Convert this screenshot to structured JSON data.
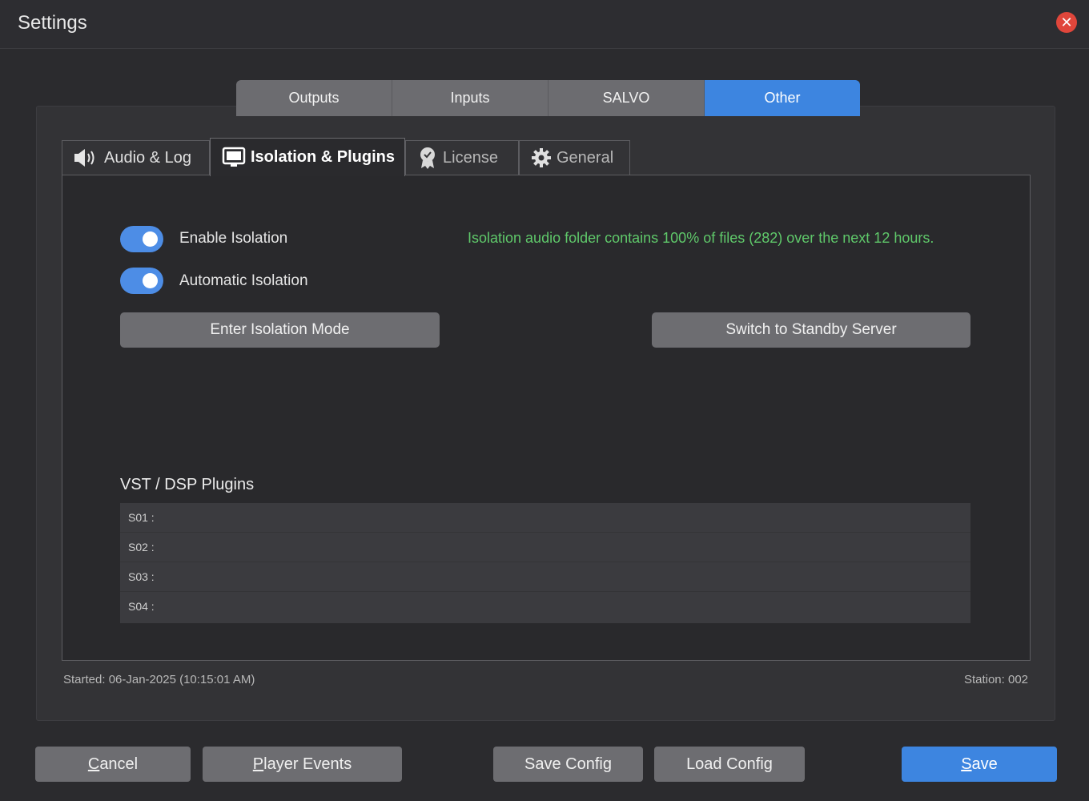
{
  "window": {
    "title": "Settings",
    "close_symbol": "✕"
  },
  "top_tabs": [
    {
      "label": "Outputs",
      "active": false
    },
    {
      "label": "Inputs",
      "active": false
    },
    {
      "label": "SALVO",
      "active": false
    },
    {
      "label": "Other",
      "active": true
    }
  ],
  "sub_tabs": [
    {
      "label": "Audio & Log",
      "icon": "speaker-icon",
      "active": false
    },
    {
      "label": "Isolation & Plugins",
      "icon": "monitor-icon",
      "active": true
    },
    {
      "label": "License",
      "icon": "certificate-icon",
      "active": false
    },
    {
      "label": "General",
      "icon": "gear-icon",
      "active": false
    }
  ],
  "isolation": {
    "enable_label": "Enable Isolation",
    "enable_on": true,
    "auto_label": "Automatic Isolation",
    "auto_on": true,
    "status": "Isolation audio folder contains 100% of files (282) over the next 12 hours.",
    "status_color": "#5fc86a",
    "enter_button": "Enter Isolation Mode",
    "standby_button": "Switch to Standby Server"
  },
  "plugins": {
    "heading": "VST / DSP Plugins",
    "rows": [
      "S01 :",
      "S02 :",
      "S03 :",
      "S04 :"
    ]
  },
  "footer": {
    "started": "Started: 06-Jan-2025 (10:15:01 AM)",
    "station": "Station: 002"
  },
  "buttons": {
    "cancel_first": "C",
    "cancel_rest": "ancel",
    "player_first": "P",
    "player_rest": "layer Events",
    "save_config": "Save Config",
    "load_config": "Load Config",
    "save_first": "S",
    "save_rest": "ave"
  },
  "colors": {
    "accent": "#3d85e0",
    "close": "#e0463b"
  }
}
